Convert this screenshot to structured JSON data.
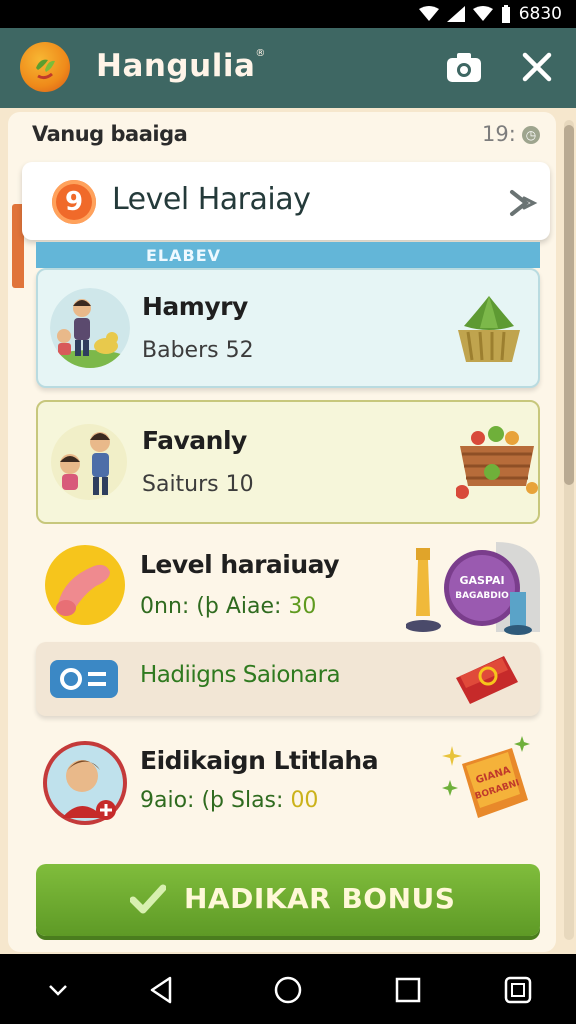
{
  "status_bar": {
    "time": "6830"
  },
  "app_bar": {
    "title": "Hangulia",
    "title_mark": "®"
  },
  "subheader": {
    "text": "Vanug baaiga",
    "count": "19:"
  },
  "level_card": {
    "badge": "9",
    "title": "Level Haraiay"
  },
  "section": {
    "label": "ELABEV"
  },
  "items": [
    {
      "title": "Hamyry",
      "subtitle": "Babers 52"
    },
    {
      "title": "Favanly",
      "subtitle": "Saiturs 10"
    },
    {
      "title": "Level haraiuay",
      "subtitle_prefix": "0nn:  (þ Aiae: ",
      "subtitle_value": "30",
      "badge_text_1": "GASPAI",
      "badge_text_2": "BAGABDIO"
    },
    {
      "title": "Hadiigns Saionara"
    },
    {
      "title": "Eidikaign Ltitlaha",
      "subtitle_prefix": "9aio: (þ Slas: ",
      "subtitle_value": "00",
      "box_text_1": "GIANA",
      "box_text_2": "BORABNI"
    }
  ],
  "bonus_button": {
    "label": "HADIKAR BONUS"
  },
  "colors": {
    "app_bar": "#3e6763",
    "accent_green": "#6eaa2f",
    "accent_orange": "#f06a2a",
    "section_blue": "#63b6d8"
  }
}
